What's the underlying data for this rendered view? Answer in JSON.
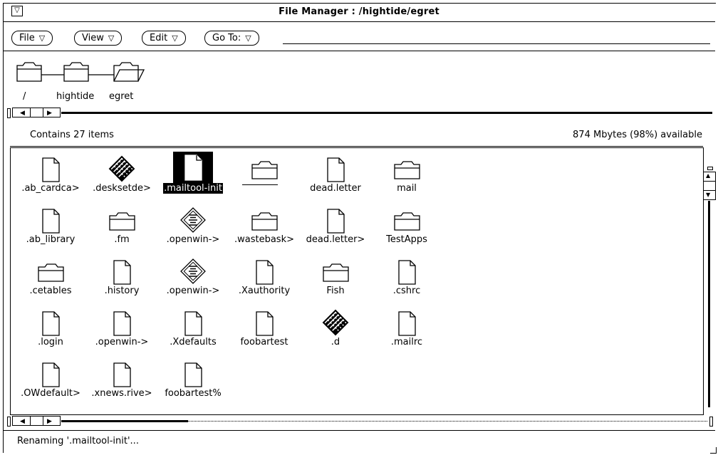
{
  "window": {
    "title": "File Manager : /hightide/egret",
    "menu_button_glyph": "▽"
  },
  "menubar": {
    "buttons": [
      {
        "label": "File",
        "glyph": "▽"
      },
      {
        "label": "View",
        "glyph": "▽"
      },
      {
        "label": "Edit",
        "glyph": "▽"
      },
      {
        "label": "Go To:",
        "glyph": "▽"
      }
    ],
    "goto_value": ""
  },
  "path": {
    "segments": [
      "/",
      "hightide",
      "egret"
    ]
  },
  "status": {
    "count": "Contains 27 items",
    "space": "874 Mbytes (98%) available"
  },
  "files": [
    {
      "name": ".ab_cardca>",
      "icon": "document-icon"
    },
    {
      "name": ".desksetde>",
      "icon": "sun-app-icon"
    },
    {
      "name": ".mailtool-init",
      "icon": "document-icon",
      "selected": true,
      "renaming": true
    },
    {
      "name": "",
      "icon": "folder-icon"
    },
    {
      "name": "dead.letter",
      "icon": "document-icon"
    },
    {
      "name": "mail",
      "icon": "folder-icon"
    },
    {
      "name": ".ab_library",
      "icon": "document-icon"
    },
    {
      "name": ".fm",
      "icon": "folder-icon"
    },
    {
      "name": ".openwin->",
      "icon": "script-icon"
    },
    {
      "name": ".wastebask>",
      "icon": "folder-icon"
    },
    {
      "name": "dead.letter>",
      "icon": "document-icon"
    },
    {
      "name": "TestApps",
      "icon": "folder-icon"
    },
    {
      "name": ".cetables",
      "icon": "folder-icon"
    },
    {
      "name": ".history",
      "icon": "document-icon"
    },
    {
      "name": ".openwin->",
      "icon": "script-icon"
    },
    {
      "name": ".Xauthority",
      "icon": "document-icon"
    },
    {
      "name": "Fish",
      "icon": "folder-icon"
    },
    {
      "name": ".cshrc",
      "icon": "document-icon"
    },
    {
      "name": ".login",
      "icon": "document-icon"
    },
    {
      "name": ".openwin->",
      "icon": "document-icon"
    },
    {
      "name": ".Xdefaults",
      "icon": "document-icon"
    },
    {
      "name": "foobartest",
      "icon": "document-icon"
    },
    {
      "name": ".d",
      "icon": "sun-app-icon"
    },
    {
      "name": ".mailrc",
      "icon": "document-icon"
    },
    {
      "name": ".OWdefault>",
      "icon": "document-icon"
    },
    {
      "name": ".xnews.rive>",
      "icon": "document-icon"
    },
    {
      "name": "foobartest%",
      "icon": "document-icon"
    }
  ],
  "footer": {
    "message": "Renaming '.mailtool-init'..."
  }
}
